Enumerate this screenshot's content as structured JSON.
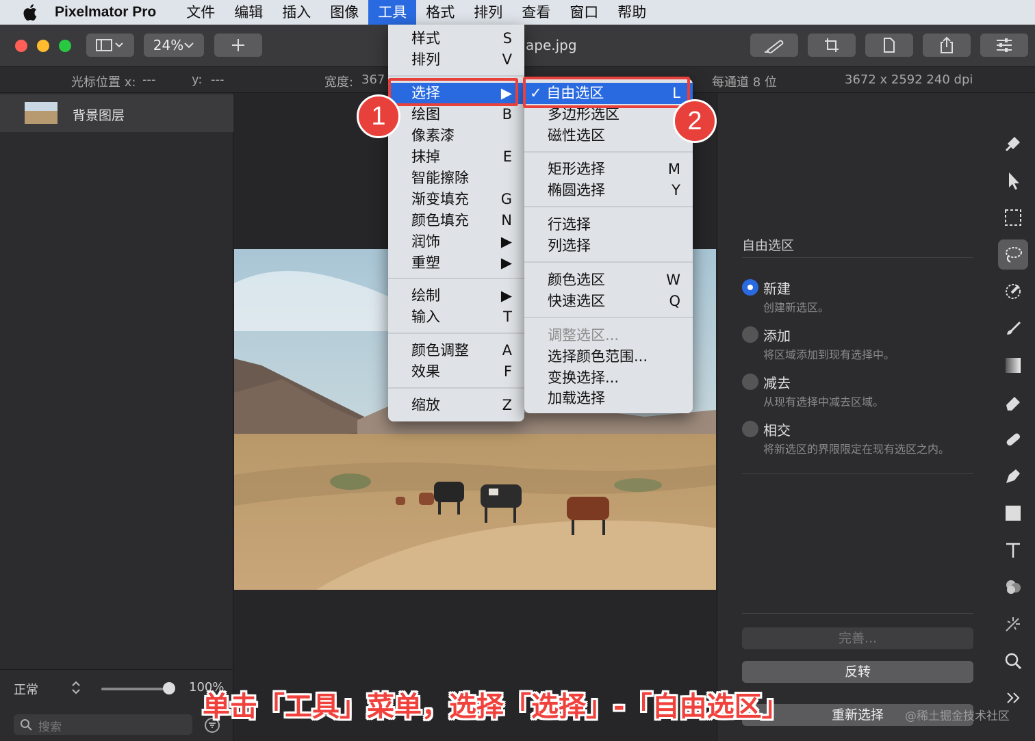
{
  "menubar": {
    "app_name": "Pixelmator Pro",
    "items": [
      "文件",
      "编辑",
      "插入",
      "图像",
      "工具",
      "格式",
      "排列",
      "查看",
      "窗口",
      "帮助"
    ],
    "active_index": 4
  },
  "toolbar": {
    "zoom": "24%",
    "doc_title_partial": "ape.jpg"
  },
  "infobar": {
    "cursor_x_label": "光标位置 x:",
    "cursor_x_value": "---",
    "cursor_y_label": "y:",
    "cursor_y_value": "---",
    "width_label": "宽度:",
    "width_value_partial": "367",
    "bits": "每通道 8 位",
    "size_dpi": "3672 x 2592 240 dpi"
  },
  "layers": {
    "items": [
      {
        "name": "背景图层"
      }
    ]
  },
  "layers_footer": {
    "blend_mode": "正常",
    "opacity": "100%",
    "search_placeholder": "搜索"
  },
  "tools_menu": {
    "items": [
      {
        "label": "样式",
        "key": "S"
      },
      {
        "label": "排列",
        "key": "V"
      },
      {
        "label": "选择",
        "key": "▶"
      },
      {
        "label": "绘图",
        "key": "B"
      },
      {
        "label": "像素漆",
        "key": ""
      },
      {
        "label": "抹掉",
        "key": "E"
      },
      {
        "label": "智能擦除",
        "key": ""
      },
      {
        "label": "渐变填充",
        "key": "G"
      },
      {
        "label": "颜色填充",
        "key": "N"
      },
      {
        "label": "润饰",
        "key": "▶"
      },
      {
        "label": "重塑",
        "key": "▶"
      },
      {
        "label": "绘制",
        "key": "▶"
      },
      {
        "label": "输入",
        "key": "T"
      },
      {
        "label": "颜色调整",
        "key": "A"
      },
      {
        "label": "效果",
        "key": "F"
      },
      {
        "label": "缩放",
        "key": "Z"
      }
    ]
  },
  "select_submenu": {
    "items": [
      {
        "label": "✓ 自由选区",
        "key": "L"
      },
      {
        "label": "多边形选区",
        "key": ""
      },
      {
        "label": "磁性选区",
        "key": ""
      },
      {
        "label": "矩形选择",
        "key": "M"
      },
      {
        "label": "椭圆选择",
        "key": "Y"
      },
      {
        "label": "行选择",
        "key": ""
      },
      {
        "label": "列选择",
        "key": ""
      },
      {
        "label": "颜色选区",
        "key": "W"
      },
      {
        "label": "快速选区",
        "key": "Q"
      },
      {
        "label": "调整选区...",
        "key": ""
      },
      {
        "label": "选择颜色范围...",
        "key": ""
      },
      {
        "label": "变换选择...",
        "key": ""
      },
      {
        "label": "加载选择",
        "key": ""
      }
    ]
  },
  "inspector": {
    "title": "自由选区",
    "options": [
      {
        "label": "新建",
        "desc": "创建新选区。"
      },
      {
        "label": "添加",
        "desc": "将区域添加到现有选择中。"
      },
      {
        "label": "减去",
        "desc": "从现有选择中减去区域。"
      },
      {
        "label": "相交",
        "desc": "将新选区的界限限定在现有选区之内。"
      }
    ],
    "selected_option": "新建",
    "refine_button": "完善...",
    "invert_button": "反转",
    "reselect_button": "重新选择"
  },
  "annotations": {
    "badge1": "1",
    "badge2": "2",
    "caption": "单击「工具」菜单，选择「选择」-「自由选区」"
  },
  "watermark": "@稀土掘金技术社区",
  "colors": {
    "accent": "#2a6ae0",
    "annotation_red": "#e8403a"
  }
}
